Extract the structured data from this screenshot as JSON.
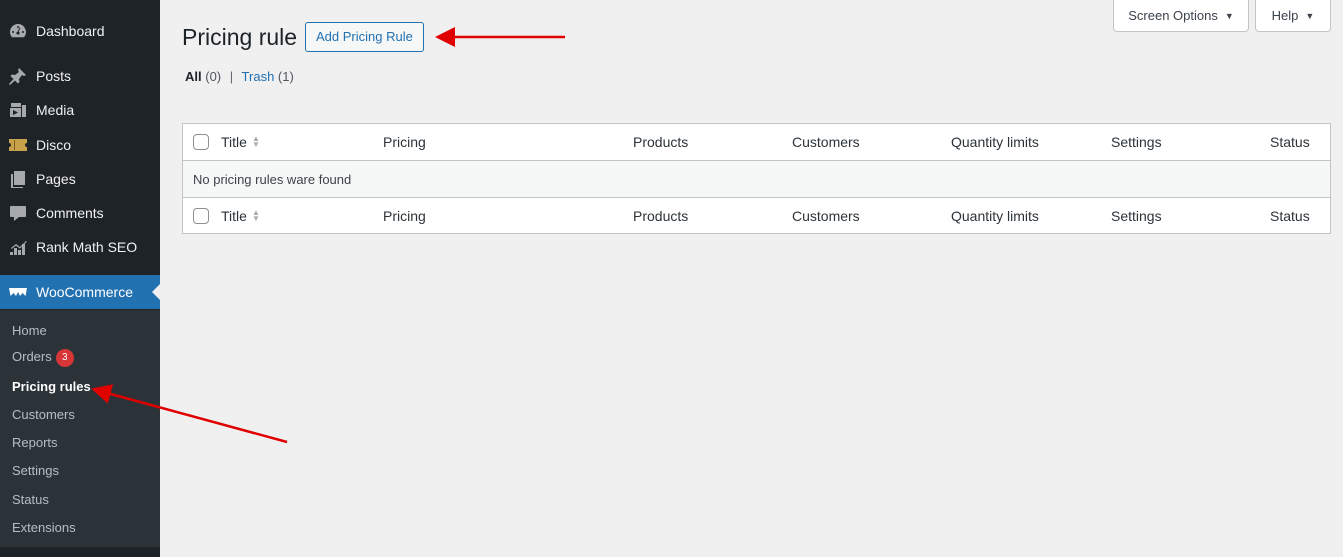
{
  "sidebar": {
    "items": [
      {
        "label": "Dashboard",
        "icon": "dashboard-icon"
      },
      {
        "label": "Posts",
        "icon": "pushpin-icon"
      },
      {
        "label": "Media",
        "icon": "media-icon"
      },
      {
        "label": "Disco",
        "icon": "ticket-icon"
      },
      {
        "label": "Pages",
        "icon": "pages-icon"
      },
      {
        "label": "Comments",
        "icon": "comment-icon"
      },
      {
        "label": "Rank Math SEO",
        "icon": "chart-icon"
      },
      {
        "label": "WooCommerce",
        "icon": "woo-icon"
      }
    ],
    "submenu": [
      {
        "label": "Home"
      },
      {
        "label": "Orders",
        "badge": "3"
      },
      {
        "label": "Pricing rules"
      },
      {
        "label": "Customers"
      },
      {
        "label": "Reports"
      },
      {
        "label": "Settings"
      },
      {
        "label": "Status"
      },
      {
        "label": "Extensions"
      }
    ]
  },
  "header": {
    "title": "Pricing rule",
    "add_button": "Add Pricing Rule",
    "screen_options": "Screen Options",
    "help": "Help"
  },
  "filters": {
    "all_label": "All",
    "all_count": "(0)",
    "separator": "|",
    "trash_label": "Trash",
    "trash_count": "(1)"
  },
  "table": {
    "columns": [
      "Title",
      "Pricing",
      "Products",
      "Customers",
      "Quantity limits",
      "Settings",
      "Status"
    ],
    "empty_message": "No pricing rules ware found"
  },
  "colors": {
    "sidebar_bg": "#1d2327",
    "accent": "#2271b1",
    "badge": "#d63638",
    "annotation_arrow": "#e00000"
  }
}
